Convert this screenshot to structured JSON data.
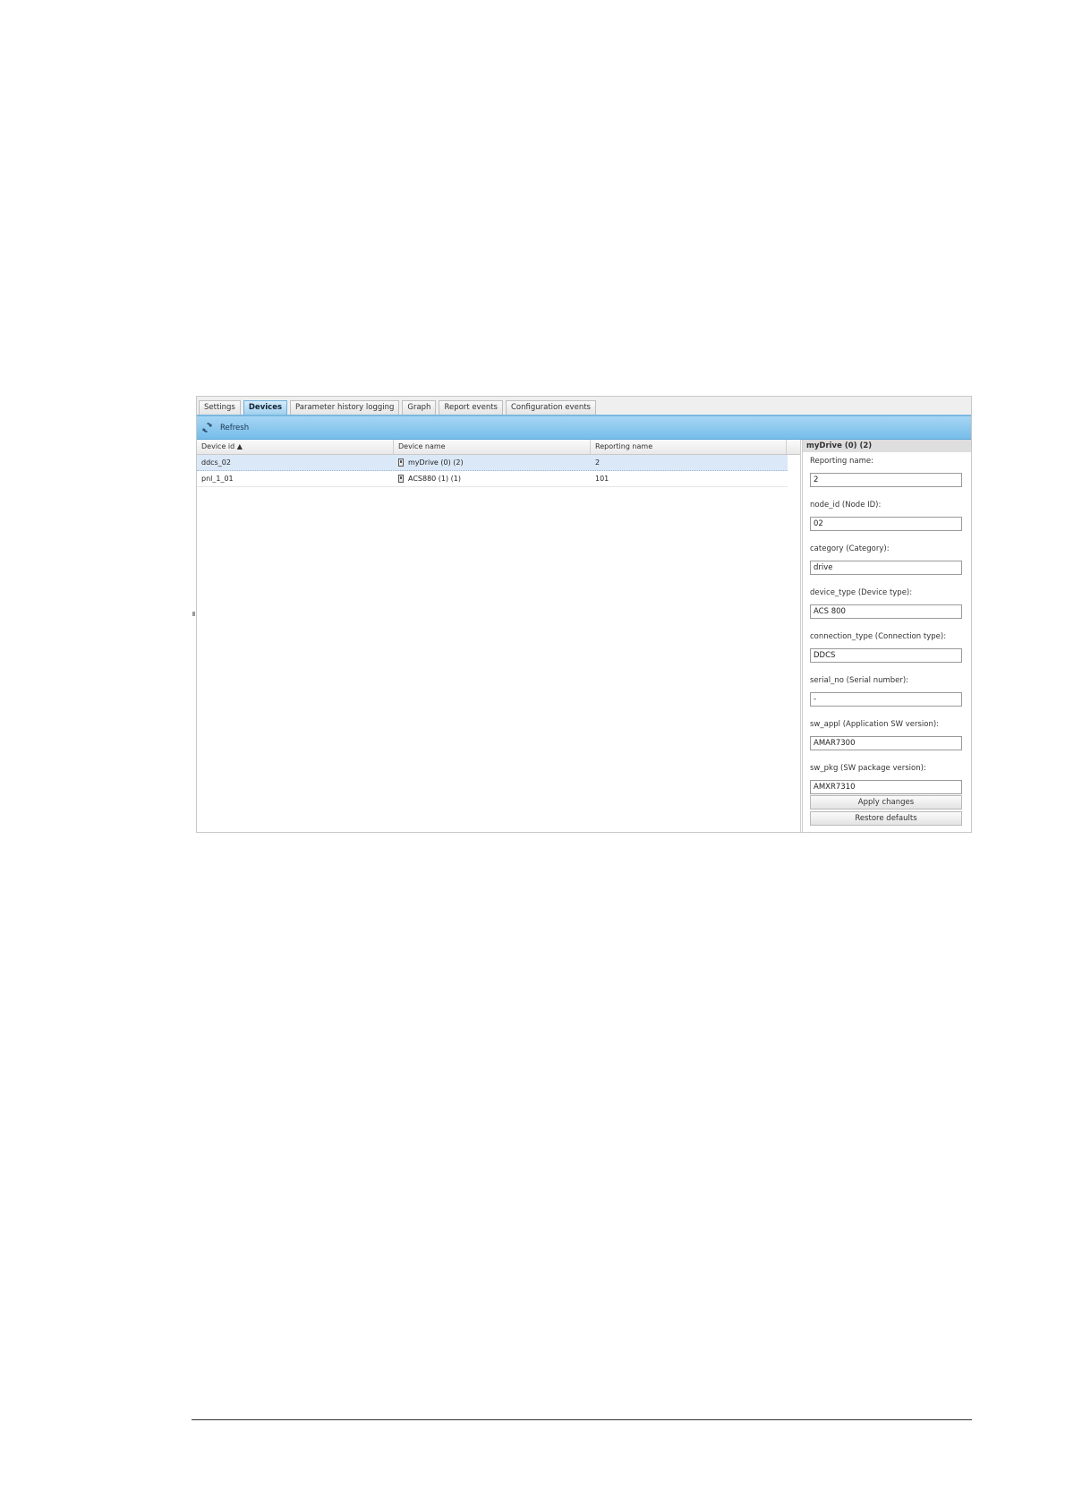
{
  "tabs": [
    {
      "label": "Settings",
      "active": false
    },
    {
      "label": "Devices",
      "active": true
    },
    {
      "label": "Parameter history logging",
      "active": false
    },
    {
      "label": "Graph",
      "active": false
    },
    {
      "label": "Report events",
      "active": false
    },
    {
      "label": "Configuration events",
      "active": false
    }
  ],
  "toolbar": {
    "refresh_label": "Refresh",
    "refresh_icon": "refresh-icon"
  },
  "grid": {
    "columns": [
      "Device id ▲",
      "Device name",
      "Reporting name"
    ],
    "rows": [
      {
        "device_id": "ddcs_02",
        "device_name": "myDrive (0) (2)",
        "reporting_name": "2",
        "selected": true
      },
      {
        "device_id": "pnl_1_01",
        "device_name": "ACS880 (1) (1)",
        "reporting_name": "101",
        "selected": false
      }
    ]
  },
  "panel": {
    "title": "myDrive (0) (2)",
    "fields": [
      {
        "label": "Reporting name:",
        "value": "2"
      },
      {
        "label": "node_id (Node ID):",
        "value": "02"
      },
      {
        "label": "category (Category):",
        "value": "drive"
      },
      {
        "label": "device_type (Device type):",
        "value": "ACS 800"
      },
      {
        "label": "connection_type (Connection type):",
        "value": "DDCS"
      },
      {
        "label": "serial_no (Serial number):",
        "value": "-"
      },
      {
        "label": "sw_appl (Application SW version):",
        "value": "AMAR7300"
      },
      {
        "label": "sw_pkg (SW package version):",
        "value": "AMXR7310"
      }
    ],
    "apply_label": "Apply changes",
    "restore_label": "Restore defaults"
  }
}
